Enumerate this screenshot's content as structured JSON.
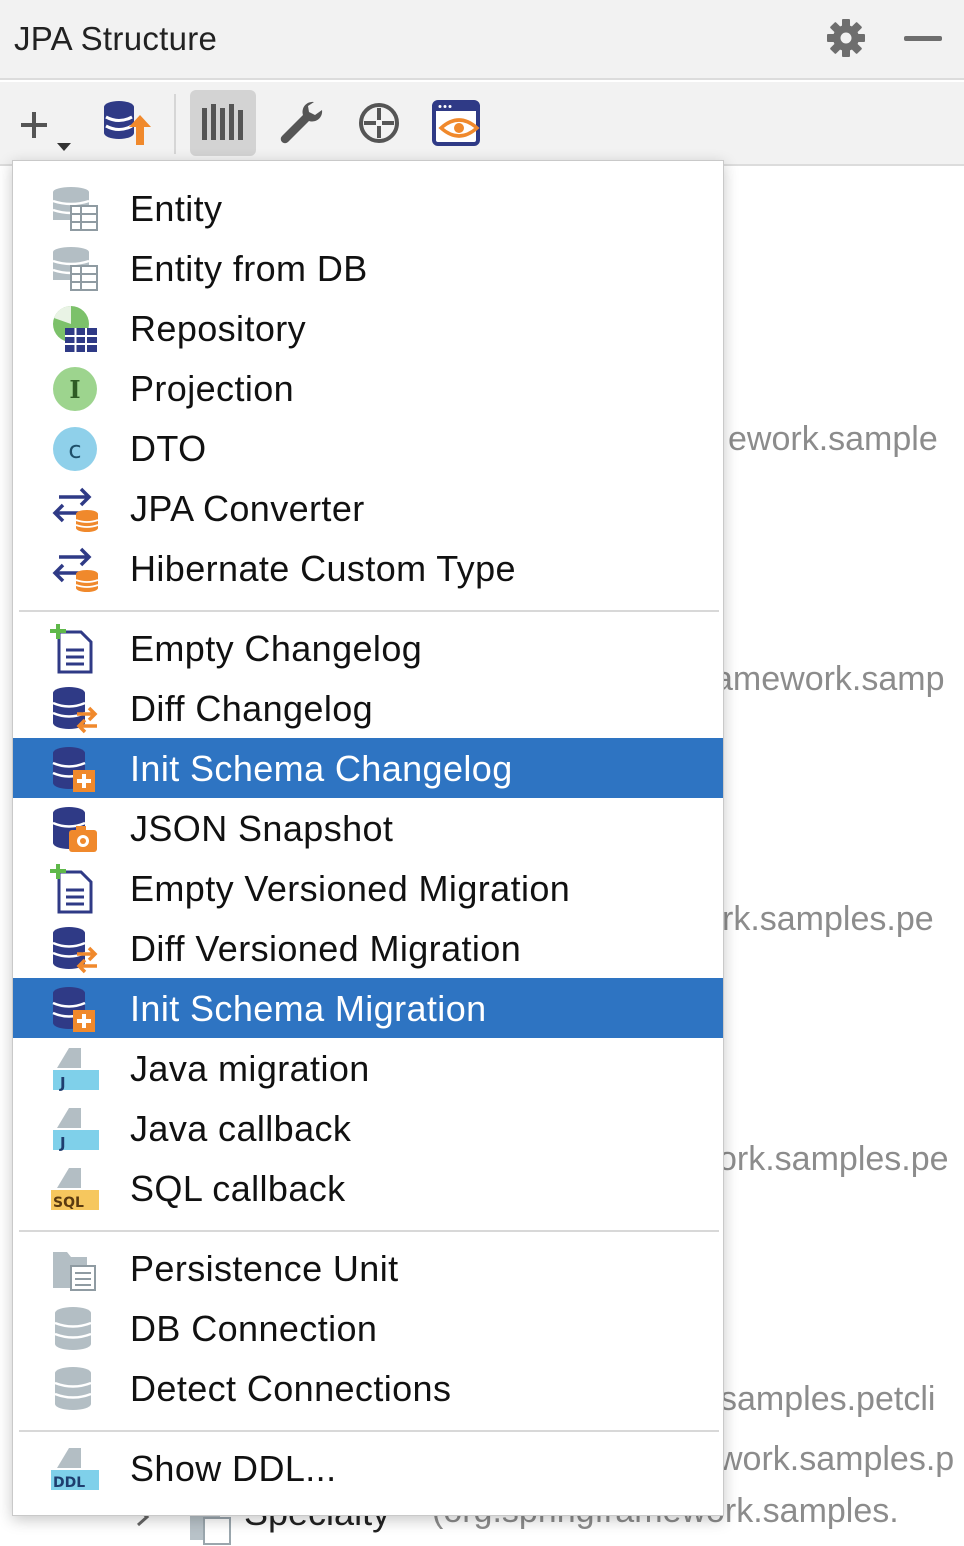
{
  "window": {
    "title": "JPA Structure"
  },
  "toolbar": {
    "buttons": [
      {
        "icon": "plus-dropdown-icon"
      },
      {
        "icon": "db-upload-icon"
      },
      {
        "icon": "columns-icon",
        "active": true
      },
      {
        "icon": "wrench-icon"
      },
      {
        "icon": "crosshair-icon"
      },
      {
        "icon": "eye-window-icon"
      }
    ]
  },
  "background_tree": {
    "lines": [
      "ework.sample",
      "amework.samp",
      "rk.samples.pe",
      "ork.samples.pe",
      "samples.petcli",
      "work.samples.p",
      "(org.springframework.samples."
    ],
    "partial_item": "Specialty"
  },
  "menu": {
    "groups": [
      [
        {
          "label": "Entity",
          "icon": "entity-icon"
        },
        {
          "label": "Entity from DB",
          "icon": "entity-from-db-icon"
        },
        {
          "label": "Repository",
          "icon": "repository-icon"
        },
        {
          "label": "Projection",
          "icon": "projection-icon"
        },
        {
          "label": "DTO",
          "icon": "dto-icon"
        },
        {
          "label": "JPA Converter",
          "icon": "jpa-converter-icon"
        },
        {
          "label": "Hibernate Custom Type",
          "icon": "hibernate-custom-type-icon"
        }
      ],
      [
        {
          "label": "Empty Changelog",
          "icon": "empty-changelog-icon"
        },
        {
          "label": "Diff Changelog",
          "icon": "diff-changelog-icon"
        },
        {
          "label": "Init Schema Changelog",
          "icon": "init-schema-icon",
          "selected": true
        },
        {
          "label": "JSON Snapshot",
          "icon": "json-snapshot-icon"
        },
        {
          "label": "Empty Versioned Migration",
          "icon": "empty-migration-icon"
        },
        {
          "label": "Diff Versioned Migration",
          "icon": "diff-migration-icon"
        },
        {
          "label": "Init Schema Migration",
          "icon": "init-schema-icon",
          "selected": true
        },
        {
          "label": "Java migration",
          "icon": "java-file-icon"
        },
        {
          "label": "Java callback",
          "icon": "java-file-icon"
        },
        {
          "label": "SQL callback",
          "icon": "sql-file-icon"
        }
      ],
      [
        {
          "label": "Persistence Unit",
          "icon": "persistence-unit-icon"
        },
        {
          "label": "DB Connection",
          "icon": "db-connection-icon"
        },
        {
          "label": "Detect Connections",
          "icon": "detect-connections-icon"
        }
      ],
      [
        {
          "label": "Show DDL...",
          "icon": "ddl-file-icon"
        }
      ]
    ]
  },
  "colors": {
    "selection": "#2e74c2",
    "accent_orange": "#f0892c",
    "db_navy": "#2f3a86",
    "green": "#5fb84a"
  }
}
